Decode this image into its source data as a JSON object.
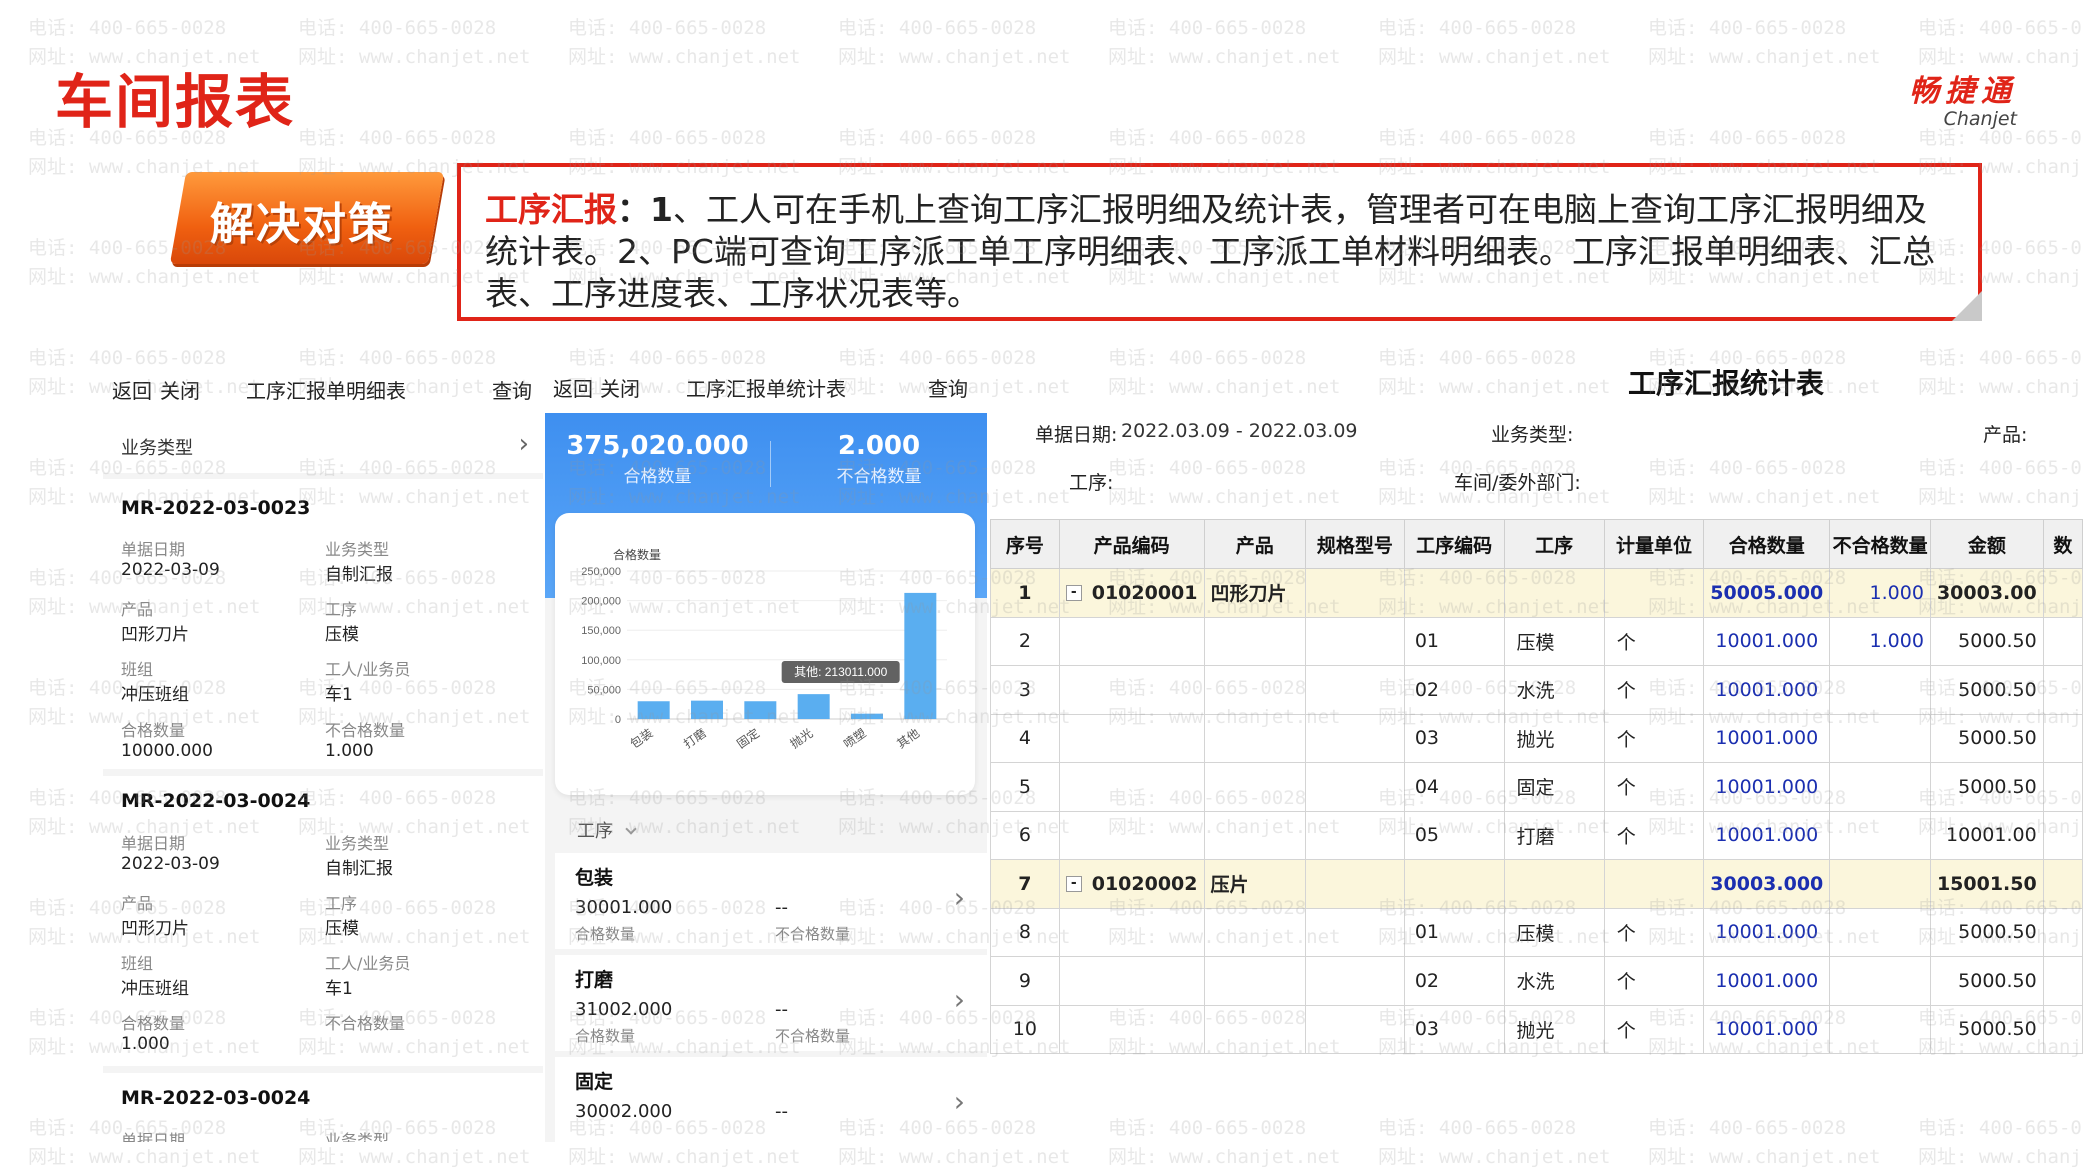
{
  "page": {
    "title": "车间报表"
  },
  "brand": {
    "cn": "畅捷通",
    "en": "Chanjet"
  },
  "ribbon": {
    "label": "解决对策"
  },
  "callout": {
    "key": "工序汇报",
    "colon": "：",
    "num": "1",
    "text": "、工人可在手机上查询工序汇报明细及统计表，管理者可在电脑上查询工序汇报明细及统计表。2、PC端可查询工序派工单工序明细表、工序派工单材料明细表。工序汇报单明细表、汇总表、工序进度表、工序状况表等。"
  },
  "watermark": {
    "line1": "电话: 400-665-0028",
    "line2": "网址: www.chanjet.net"
  },
  "mobile1": {
    "back": "返回",
    "close": "关闭",
    "title": "工序汇报单明细表",
    "query": "查询",
    "filter_label": "业务类型",
    "filter_chevron": "›",
    "cards": [
      {
        "id": "MR-2022-03-0023",
        "f": [
          {
            "l": "单据日期",
            "v": "2022-03-09"
          },
          {
            "l": "业务类型",
            "v": "自制汇报"
          },
          {
            "l": "产品",
            "v": "凹形刀片"
          },
          {
            "l": "工序",
            "v": "压模"
          },
          {
            "l": "班组",
            "v": "冲压班组"
          },
          {
            "l": "工人/业务员",
            "v": "车1"
          },
          {
            "l": "合格数量",
            "v": "10000.000"
          },
          {
            "l": "不合格数量",
            "v": "1.000"
          }
        ]
      },
      {
        "id": "MR-2022-03-0024",
        "f": [
          {
            "l": "单据日期",
            "v": "2022-03-09"
          },
          {
            "l": "业务类型",
            "v": "自制汇报"
          },
          {
            "l": "产品",
            "v": "凹形刀片"
          },
          {
            "l": "工序",
            "v": "压模"
          },
          {
            "l": "班组",
            "v": "冲压班组"
          },
          {
            "l": "工人/业务员",
            "v": "车1"
          },
          {
            "l": "合格数量",
            "v": "1.000"
          },
          {
            "l": "不合格数量",
            "v": ""
          }
        ]
      },
      {
        "id": "MR-2022-03-0024",
        "f": [
          {
            "l": "单据日期",
            "v": ""
          },
          {
            "l": "业务类型",
            "v": ""
          }
        ]
      }
    ]
  },
  "mobile2": {
    "back": "返回",
    "close": "关闭",
    "title": "工序汇报单统计表",
    "query": "查询",
    "qualified_value": "375,020.000",
    "qualified_label": "合格数量",
    "unqualified_value": "2.000",
    "unqualified_label": "不合格数量",
    "process_select": "工序",
    "process_select_icon": "chevron-down-icon",
    "processes": [
      {
        "name": "包装",
        "value": "30001.000",
        "value_label": "合格数量",
        "bad": "--",
        "bad_label": "不合格数量"
      },
      {
        "name": "打磨",
        "value": "31002.000",
        "value_label": "合格数量",
        "bad": "--",
        "bad_label": "不合格数量"
      },
      {
        "name": "固定",
        "value": "30002.000",
        "value_label": "",
        "bad": "--",
        "bad_label": ""
      }
    ]
  },
  "chart_data": {
    "type": "bar",
    "ylabel": "合格数量",
    "categories": [
      "包装",
      "打磨",
      "固定",
      "抛光",
      "喷塑",
      "其他"
    ],
    "values": [
      30001,
      31002,
      30002,
      42000,
      9000,
      213011
    ],
    "ylim": [
      0,
      250000
    ],
    "yticks": [
      "250,000",
      "200,000",
      "150,000",
      "100,000",
      "50,000",
      "0"
    ],
    "tooltip": "其他: 213011.000",
    "bar_color": "#5aaef0",
    "grid": true
  },
  "report": {
    "title": "工序汇报统计表",
    "date_label": "单据日期:",
    "date_value": "2022.03.09 - 2022.03.09",
    "type_label": "业务类型:",
    "product_label": "产品:",
    "process_label": "工序:",
    "dept_label": "车间/委外部门:",
    "columns": [
      "序号",
      "产品编码",
      "产品",
      "规格型号",
      "工序编码",
      "工序",
      "计量单位",
      "合格数量",
      "不合格数量",
      "金额",
      "数"
    ],
    "rows": [
      {
        "sub": true,
        "c": [
          "1",
          "01020001",
          "凹形刀片",
          "",
          "",
          "",
          "",
          "50005.000",
          "1.000",
          "30003.00",
          ""
        ]
      },
      {
        "sub": false,
        "c": [
          "2",
          "",
          "",
          "",
          "01",
          "压模",
          "个",
          "10001.000",
          "1.000",
          "5000.50",
          ""
        ]
      },
      {
        "sub": false,
        "c": [
          "3",
          "",
          "",
          "",
          "02",
          "水洗",
          "个",
          "10001.000",
          "",
          "5000.50",
          ""
        ]
      },
      {
        "sub": false,
        "c": [
          "4",
          "",
          "",
          "",
          "03",
          "抛光",
          "个",
          "10001.000",
          "",
          "5000.50",
          ""
        ]
      },
      {
        "sub": false,
        "c": [
          "5",
          "",
          "",
          "",
          "04",
          "固定",
          "个",
          "10001.000",
          "",
          "5000.50",
          ""
        ]
      },
      {
        "sub": false,
        "c": [
          "6",
          "",
          "",
          "",
          "05",
          "打磨",
          "个",
          "10001.000",
          "",
          "10001.00",
          ""
        ]
      },
      {
        "sub": true,
        "c": [
          "7",
          "01020002",
          "压片",
          "",
          "",
          "",
          "",
          "30003.000",
          "",
          "15001.50",
          ""
        ]
      },
      {
        "sub": false,
        "c": [
          "8",
          "",
          "",
          "",
          "01",
          "压模",
          "个",
          "10001.000",
          "",
          "5000.50",
          ""
        ]
      },
      {
        "sub": false,
        "c": [
          "9",
          "",
          "",
          "",
          "02",
          "水洗",
          "个",
          "10001.000",
          "",
          "5000.50",
          ""
        ]
      },
      {
        "sub": false,
        "c": [
          "10",
          "",
          "",
          "",
          "03",
          "抛光",
          "个",
          "10001.000",
          "",
          "5000.50",
          ""
        ]
      }
    ],
    "expander": "-"
  }
}
